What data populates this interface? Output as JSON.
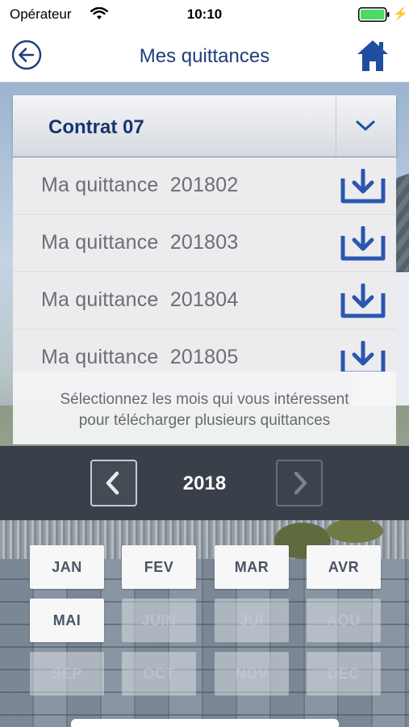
{
  "status_bar": {
    "carrier": "Opérateur",
    "time": "10:10"
  },
  "nav": {
    "title": "Mes quittances",
    "back_icon": "arrow-left-circle-icon",
    "home_icon": "home-icon",
    "accent_color": "#1e3d7b"
  },
  "contract": {
    "title": "Contrat 07",
    "expand_icon": "chevron-down-icon"
  },
  "receipts": [
    {
      "label": "Ma quittance  201802"
    },
    {
      "label": "Ma quittance  201803"
    },
    {
      "label": "Ma quittance  201804"
    },
    {
      "label": "Ma quittance  201805"
    }
  ],
  "hint": {
    "line1": "Sélectionnez les mois qui vous intéressent",
    "line2": "pour télécharger plusieurs quittances"
  },
  "year_selector": {
    "year": "2018",
    "prev_icon": "chevron-left-icon",
    "next_icon": "chevron-right-icon"
  },
  "months": [
    {
      "label": "JAN",
      "enabled": true
    },
    {
      "label": "FEV",
      "enabled": true
    },
    {
      "label": "MAR",
      "enabled": true
    },
    {
      "label": "AVR",
      "enabled": true
    },
    {
      "label": "MAI",
      "enabled": true
    },
    {
      "label": "JUIN",
      "enabled": false
    },
    {
      "label": "JUI",
      "enabled": false
    },
    {
      "label": "AOU",
      "enabled": false
    },
    {
      "label": "SEP",
      "enabled": false
    },
    {
      "label": "OCT",
      "enabled": false
    },
    {
      "label": "NOV",
      "enabled": false
    },
    {
      "label": "DEC",
      "enabled": false
    }
  ]
}
